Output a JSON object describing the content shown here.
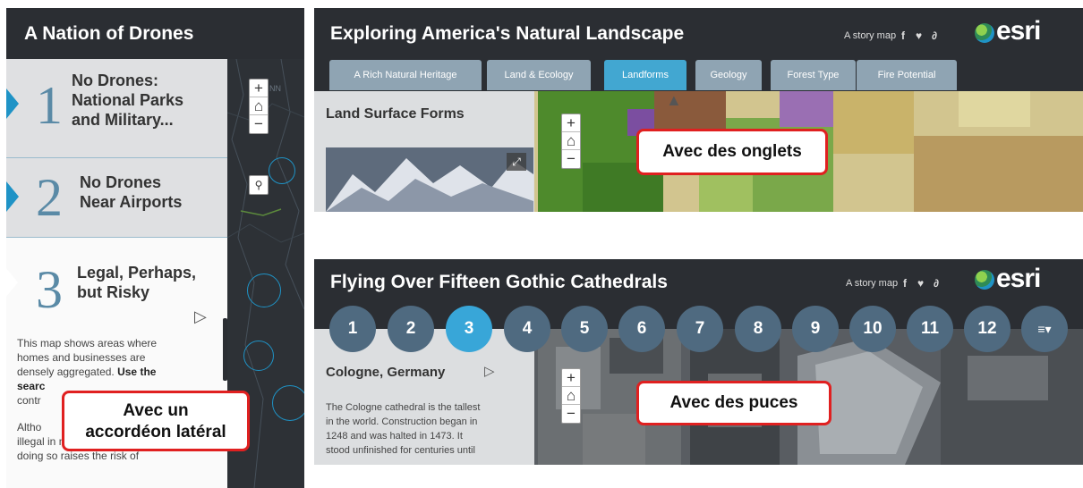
{
  "left_panel": {
    "title": "A Nation of Drones",
    "items": [
      {
        "number": "1",
        "title_lines": [
          "No Drones:",
          "National Parks",
          "and Military..."
        ]
      },
      {
        "number": "2",
        "title_lines": [
          "No Drones",
          "Near Airports"
        ]
      },
      {
        "number": "3",
        "title_lines": [
          "Legal, Perhaps,",
          "but Risky"
        ]
      }
    ],
    "body_lines": [
      "This map shows areas where",
      "homes and businesses are",
      "densely aggregated.",
      "Use the",
      "searc",
      "contr",
      "Altho",
      "illegal in most of these areas,",
      "doing so raises the risk of"
    ],
    "map_controls": {
      "zoom_in": "+",
      "home": "⌂",
      "zoom_out": "−",
      "search": "⚲"
    },
    "map_label": "NN",
    "callout_lines": [
      "Avec un",
      "accordéon latéral"
    ]
  },
  "story_top": {
    "title": "Exploring America's Natural Landscape",
    "meta": "A story map",
    "brand": "esri",
    "social_icons": [
      "facebook-icon",
      "twitter-icon",
      "link-icon"
    ],
    "social_glyphs": {
      "facebook": "f",
      "twitter": "♥",
      "link": "∂"
    },
    "tabs": [
      "A Rich Natural Heritage",
      "Land & Ecology",
      "Landforms",
      "Geology",
      "Forest Type",
      "Fire Potential"
    ],
    "active_tab": "Landforms",
    "side_title": "Land Surface Forms",
    "expand_glyph": "⤢",
    "map_controls": {
      "zoom_in": "+",
      "home": "⌂",
      "zoom_out": "−"
    },
    "callout": "Avec des onglets"
  },
  "story_bottom": {
    "title": "Flying Over Fifteen Gothic Cathedrals",
    "meta": "A story map",
    "brand": "esri",
    "social_glyphs": {
      "facebook": "f",
      "twitter": "♥",
      "link": "∂"
    },
    "bullets": [
      "1",
      "2",
      "3",
      "4",
      "5",
      "6",
      "7",
      "8",
      "9",
      "10",
      "11",
      "12"
    ],
    "active_bullet": "3",
    "list_button": "≡▾",
    "side_title": "Cologne, Germany",
    "side_body_lines": [
      "The Cologne cathedral is the tallest",
      "in the world. Construction began in",
      "1248 and was halted in 1473. It",
      "stood unfinished for centuries until"
    ],
    "map_controls": {
      "zoom_in": "+",
      "home": "⌂",
      "zoom_out": "−"
    },
    "callout": "Avec des puces"
  },
  "colors": {
    "header_bg": "#2b2e33",
    "accent_blue": "#1f93c6",
    "tab_bg": "#8fa4b3",
    "tab_active": "#42a7d1",
    "bullet_bg": "#4f6a80",
    "bullet_active": "#38a6d8",
    "callout_border": "#e02020"
  }
}
